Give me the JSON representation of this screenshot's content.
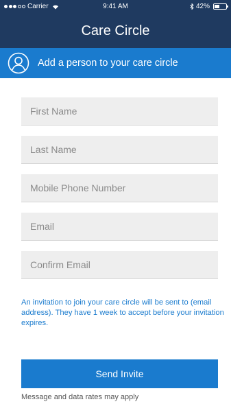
{
  "status_bar": {
    "carrier": "Carrier",
    "time": "9:41 AM",
    "battery": "42%",
    "battery_level": 0.42,
    "signal_filled": 3,
    "signal_total": 5
  },
  "header": {
    "title": "Care Circle"
  },
  "banner": {
    "label": "Add a person to your care circle",
    "icon": "person-circle-icon"
  },
  "form": {
    "first_name_placeholder": "First Name",
    "last_name_placeholder": "Last Name",
    "mobile_placeholder": "Mobile Phone Number",
    "email_placeholder": "Email",
    "confirm_email_placeholder": "Confirm Email"
  },
  "invite_note": "An invitation to join your care circle will be sent to (email address).  They have 1 week to accept before your invitation expires.",
  "send_button_label": "Send Invite",
  "rates_note": "Message and data rates may apply",
  "colors": {
    "header_bg": "#1f3a60",
    "accent": "#1a7bce",
    "field_bg": "#eeeeee",
    "muted_text": "#555555"
  }
}
